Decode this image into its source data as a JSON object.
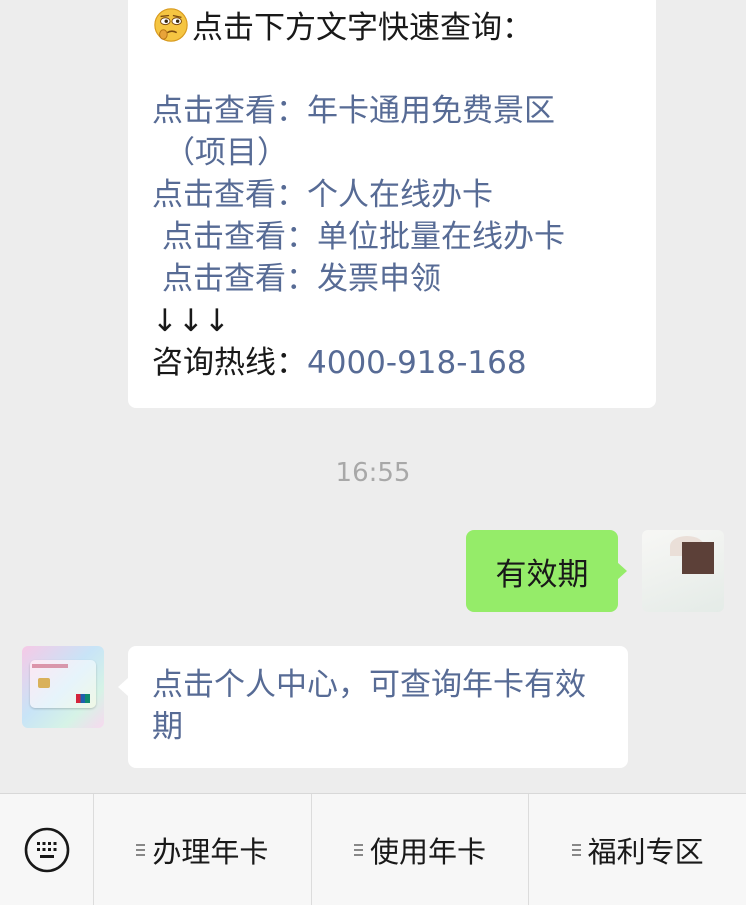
{
  "chat": {
    "top_message": {
      "emoji": "thinking-face-emoji",
      "intro": "点击下方文字快速查询：",
      "links": [
        {
          "prefix": "点击查看：",
          "text": "年卡通用免费景区"
        },
        {
          "prefix": "",
          "text": "（项目）"
        },
        {
          "prefix": "点击查看：",
          "text": "个人在线办卡"
        },
        {
          "prefix": "点击查看：",
          "text": "单位批量在线办卡"
        },
        {
          "prefix": "点击查看：",
          "text": "发票申领"
        }
      ],
      "arrows": "↓↓↓",
      "hotline_label": "咨询热线：",
      "hotline_number": "4000-918-168"
    },
    "timestamp": "16:55",
    "my_message": "有效期",
    "bot_reply": "点击个人中心，可查询年卡有效期"
  },
  "menu": {
    "keyboard_icon": "keyboard-icon",
    "items": [
      {
        "label": "办理年卡"
      },
      {
        "label": "使用年卡"
      },
      {
        "label": "福利专区"
      }
    ]
  },
  "colors": {
    "background": "#ededed",
    "link": "#576b95",
    "my_bubble": "#95ec69",
    "bubble": "#ffffff",
    "timestamp": "#a8a8a8"
  }
}
